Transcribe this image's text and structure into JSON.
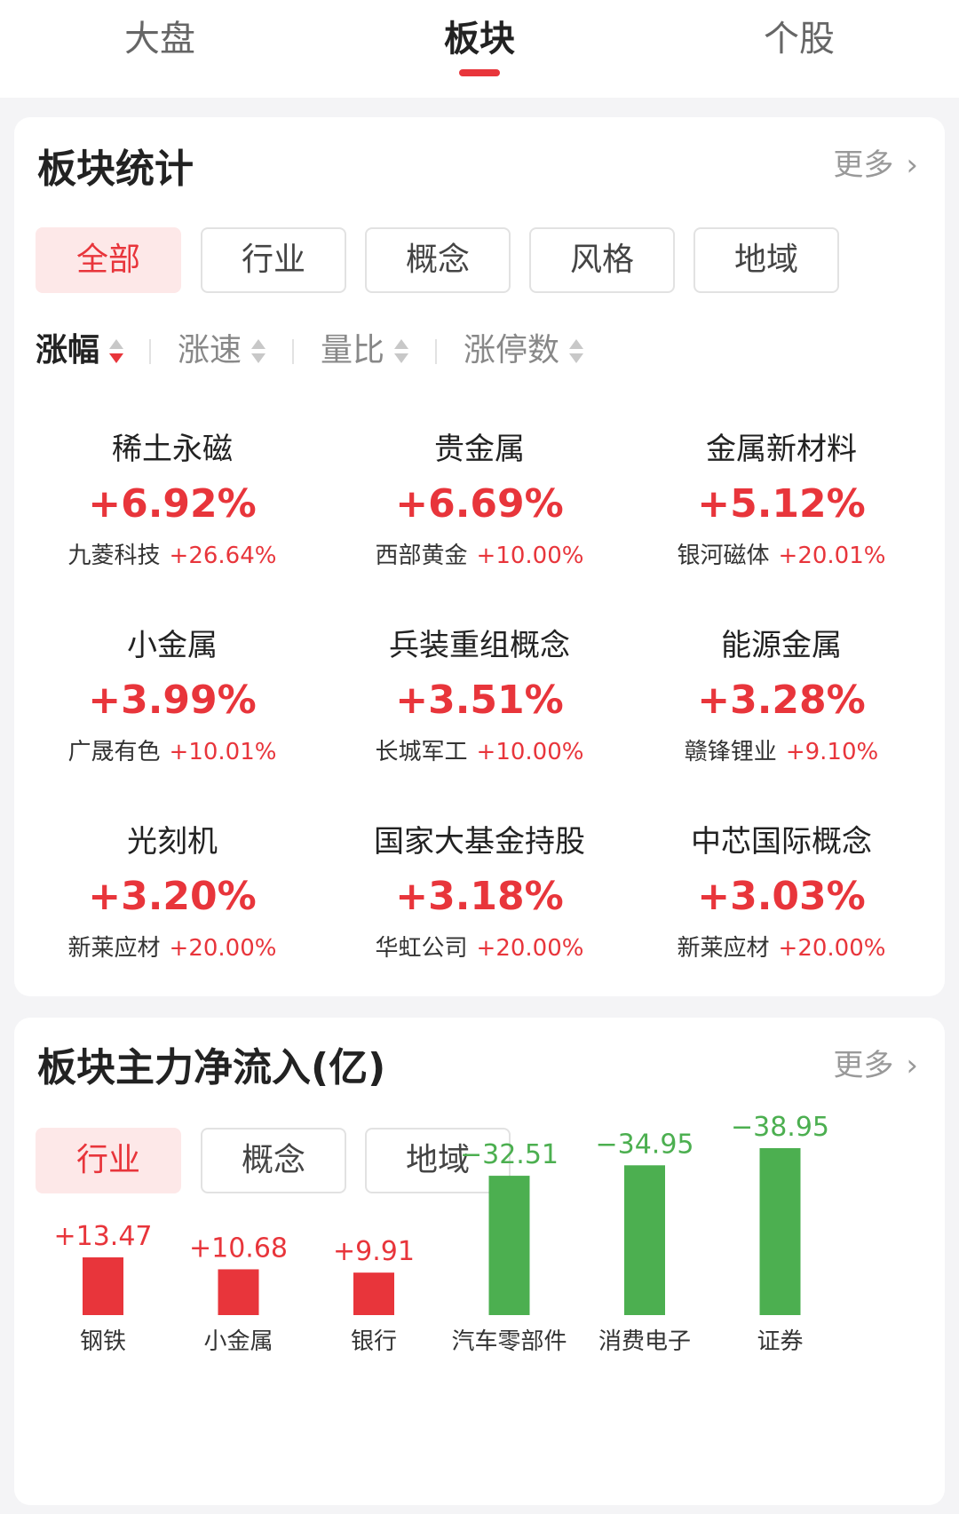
{
  "top_tabs": [
    {
      "label": "大盘",
      "active": false
    },
    {
      "label": "板块",
      "active": true
    },
    {
      "label": "个股",
      "active": false
    }
  ],
  "colors": {
    "accent": "#e8353b",
    "up": "#e8353b",
    "down": "#4caf50",
    "pill_active_bg": "#fde8e8"
  },
  "stats": {
    "title": "板块统计",
    "more": "更多",
    "filters": [
      {
        "label": "全部",
        "active": true
      },
      {
        "label": "行业",
        "active": false
      },
      {
        "label": "概念",
        "active": false
      },
      {
        "label": "风格",
        "active": false
      },
      {
        "label": "地域",
        "active": false
      }
    ],
    "sorts": [
      {
        "label": "涨幅",
        "active": true,
        "direction": "desc"
      },
      {
        "label": "涨速",
        "active": false
      },
      {
        "label": "量比",
        "active": false
      },
      {
        "label": "涨停数",
        "active": false
      }
    ],
    "sectors": [
      {
        "name": "稀土永磁",
        "pct": "+6.92%",
        "lead": "九菱科技",
        "lead_pct": "+26.64%"
      },
      {
        "name": "贵金属",
        "pct": "+6.69%",
        "lead": "西部黄金",
        "lead_pct": "+10.00%"
      },
      {
        "name": "金属新材料",
        "pct": "+5.12%",
        "lead": "银河磁体",
        "lead_pct": "+20.01%"
      },
      {
        "name": "小金属",
        "pct": "+3.99%",
        "lead": "广晟有色",
        "lead_pct": "+10.01%"
      },
      {
        "name": "兵装重组概念",
        "pct": "+3.51%",
        "lead": "长城军工",
        "lead_pct": "+10.00%"
      },
      {
        "name": "能源金属",
        "pct": "+3.28%",
        "lead": "赣锋锂业",
        "lead_pct": "+9.10%"
      },
      {
        "name": "光刻机",
        "pct": "+3.20%",
        "lead": "新莱应材",
        "lead_pct": "+20.00%"
      },
      {
        "name": "国家大基金持股",
        "pct": "+3.18%",
        "lead": "华虹公司",
        "lead_pct": "+20.00%"
      },
      {
        "name": "中芯国际概念",
        "pct": "+3.03%",
        "lead": "新莱应材",
        "lead_pct": "+20.00%"
      }
    ]
  },
  "flow": {
    "title": "板块主力净流入(亿)",
    "more": "更多",
    "filters": [
      {
        "label": "行业",
        "active": true
      },
      {
        "label": "概念",
        "active": false
      },
      {
        "label": "地域",
        "active": false
      }
    ]
  },
  "chart_data": {
    "type": "bar",
    "categories": [
      "钢铁",
      "小金属",
      "银行",
      "汽车零部件",
      "消费电子",
      "证券"
    ],
    "values": [
      13.47,
      10.68,
      9.91,
      -32.51,
      -34.95,
      -38.95
    ],
    "labels": [
      "+13.47",
      "+10.68",
      "+9.91",
      "−32.51",
      "−34.95",
      "−38.95"
    ],
    "bar_height_basis": "absolute value",
    "positive_color": "#e8353b",
    "negative_color": "#4caf50"
  }
}
